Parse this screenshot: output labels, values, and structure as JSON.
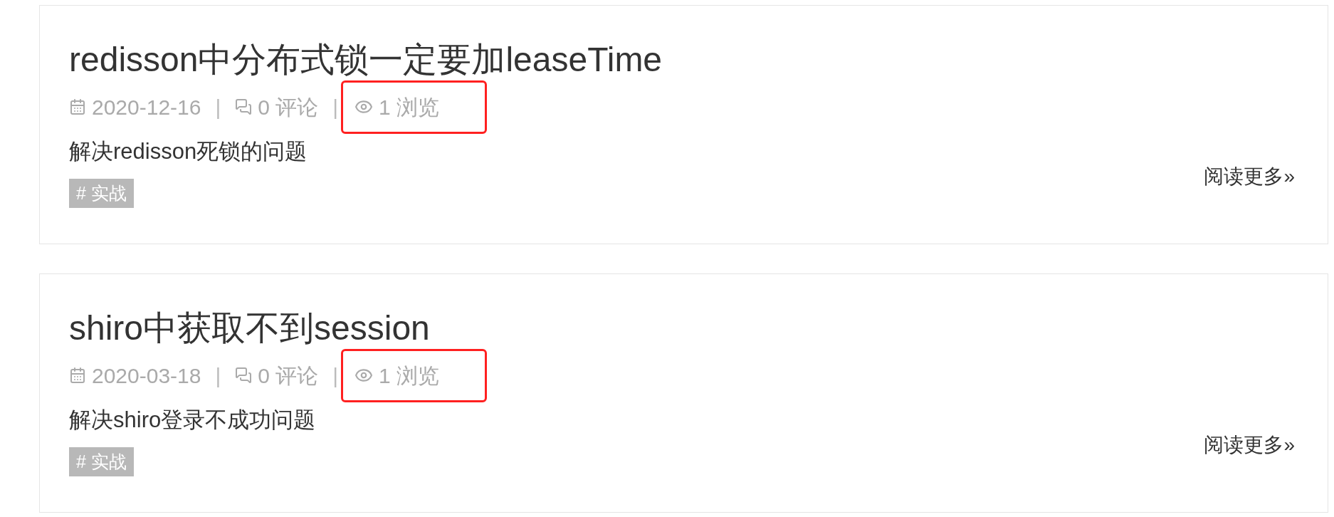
{
  "separator": "|",
  "posts": [
    {
      "title": "redisson中分布式锁一定要加leaseTime",
      "date": "2020-12-16",
      "comments": "0 评论",
      "views": "1 浏览",
      "views_highlighted": true,
      "summary": "解决redisson死锁的问题",
      "tags": [
        "# 实战"
      ],
      "read_more": "阅读更多»"
    },
    {
      "title": "shiro中获取不到session",
      "date": "2020-03-18",
      "comments": "0 评论",
      "views": "1 浏览",
      "views_highlighted": true,
      "summary": "解决shiro登录不成功问题",
      "tags": [
        "# 实战"
      ],
      "read_more": "阅读更多»"
    }
  ]
}
